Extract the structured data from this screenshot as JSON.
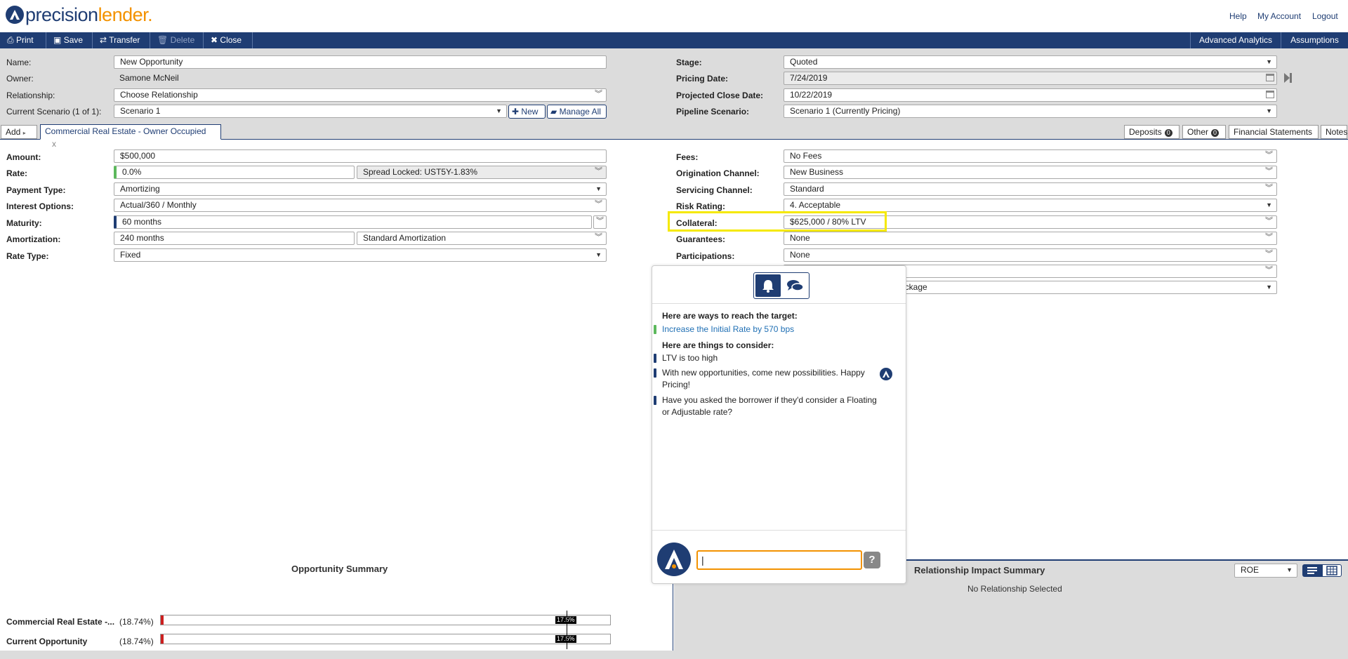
{
  "header": {
    "logo_part1": "precision",
    "logo_part2": "lender.",
    "links": [
      "Help",
      "My Account",
      "Logout"
    ]
  },
  "toolbar": {
    "print": "Print",
    "save": "Save",
    "transfer": "Transfer",
    "delete": "Delete",
    "close": "Close",
    "advanced_analytics": "Advanced Analytics",
    "assumptions": "Assumptions"
  },
  "opportunity": {
    "name_label": "Name:",
    "name_value": "New Opportunity",
    "owner_label": "Owner:",
    "owner_value": "Samone McNeil",
    "relationship_label": "Relationship:",
    "relationship_value": "Choose Relationship",
    "scenario_label": "Current Scenario (1 of 1):",
    "scenario_value": "Scenario 1",
    "new_button": "New",
    "manage_all_button": "Manage All",
    "stage_label": "Stage:",
    "stage_value": "Quoted",
    "pricing_date_label": "Pricing Date:",
    "pricing_date_value": "7/24/2019",
    "close_date_label": "Projected Close Date:",
    "close_date_value": "10/22/2019",
    "pipeline_label": "Pipeline Scenario:",
    "pipeline_value": "Scenario 1 (Currently Pricing)"
  },
  "tabs": {
    "add": "Add",
    "active": "Commercial Real Estate - Owner Occupied",
    "close_x": "x",
    "deposits": "Deposits",
    "deposits_count": "0",
    "other": "Other",
    "other_count": "0",
    "financial_statements": "Financial Statements",
    "notes": "Notes"
  },
  "loan": {
    "amount_label": "Amount:",
    "amount_value": "$500,000",
    "rate_label": "Rate:",
    "rate_value": "0.0%",
    "spread_value": "Spread Locked: UST5Y-1.83%",
    "payment_label": "Payment Type:",
    "payment_value": "Amortizing",
    "interest_label": "Interest Options:",
    "interest_value": "Actual/360 / Monthly",
    "maturity_label": "Maturity:",
    "maturity_value": "60 months",
    "amortization_label": "Amortization:",
    "amortization_value": "240 months",
    "amortization_type": "Standard Amortization",
    "ratetype_label": "Rate Type:",
    "ratetype_value": "Fixed",
    "fees_label": "Fees:",
    "fees_value": "No Fees",
    "origination_label": "Origination Channel:",
    "origination_value": "New Business",
    "servicing_label": "Servicing Channel:",
    "servicing_value": "Standard",
    "risk_label": "Risk Rating:",
    "risk_value": "4. Acceptable",
    "collateral_label": "Collateral:",
    "collateral_value": "$625,000 / 80% LTV",
    "guarantees_label": "Guarantees:",
    "guarantees_value": "None",
    "participations_label": "Participations:",
    "participations_value": "None",
    "hidden_partial": "ackage"
  },
  "chat": {
    "heading_target": "Here are ways to reach the target:",
    "target_link": "Increase the Initial Rate by 570 bps",
    "heading_consider": "Here are things to consider:",
    "consider_items": [
      "LTV is too high",
      "With new opportunities, come new possibilities. Happy Pricing!",
      "Have you asked the borrower if they'd consider a Floating or Adjustable rate?"
    ],
    "input_value": "|",
    "help_glyph": "?"
  },
  "summary": {
    "title": "Opportunity Summary",
    "rows": [
      {
        "label": "Commercial Real Estate -...",
        "pct": "(18.74%)",
        "marker": "17.5%"
      },
      {
        "label": "Current Opportunity",
        "pct": "(18.74%)",
        "marker": "17.5%"
      }
    ]
  },
  "relationship_summary": {
    "title": "Relationship Impact Summary",
    "metric": "ROE",
    "empty_text": "No Relationship Selected"
  },
  "colors": {
    "brand_navy": "#1f3d73",
    "brand_orange": "#f39200",
    "highlight": "#f5e900"
  }
}
